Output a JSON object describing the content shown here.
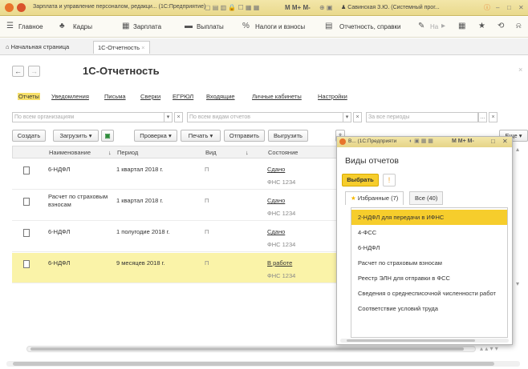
{
  "window": {
    "title": "Зарплата и управление персоналом, редакци... (1С:Предприятие)",
    "user": "Савинская З.Ю. (Системный прог..."
  },
  "menubar": {
    "items": [
      "Главное",
      "Кадры",
      "Зарплата",
      "Выплаты",
      "Налоги и взносы",
      "Отчетность, справки",
      "На"
    ]
  },
  "tabs": {
    "home": "Начальная страница",
    "active": "1С-Отчетность"
  },
  "page": {
    "title": "1С-Отчетность",
    "links": [
      "Отчеты",
      "Уведомления",
      "Письма",
      "Сверки",
      "ЕГРЮЛ",
      "Входящие",
      "Личные кабинеты",
      "Настройки"
    ],
    "filters": {
      "org_placeholder": "По всем организациям",
      "type_placeholder": "По всем видам отчетов",
      "period_placeholder": "За все периоды"
    },
    "toolbar": {
      "create": "Создать",
      "load": "Загрузить",
      "check": "Проверка",
      "print": "Печать",
      "send": "Отправить",
      "export": "Выгрузить",
      "more": "Еще"
    }
  },
  "table": {
    "columns": [
      "Наименование",
      "Период",
      "Вид",
      "Состояние"
    ],
    "rows": [
      {
        "name": "6-НДФЛ",
        "period": "1 квартал 2018 г.",
        "kind": "П",
        "status": "Сдано",
        "sub": "ФНС 1234"
      },
      {
        "name": "Расчет по страховым взносам",
        "period": "1 квартал 2018 г.",
        "kind": "П",
        "status": "Сдано",
        "sub": "ФНС 1234"
      },
      {
        "name": "6-НДФЛ",
        "period": "1 полугодие 2018 г.",
        "kind": "П",
        "status": "Сдано",
        "sub": "ФНС 1234"
      },
      {
        "name": "6-НДФЛ",
        "period": "9 месяцев 2018 г.",
        "kind": "П",
        "status": "В работе",
        "sub": "ФНС 1234"
      }
    ]
  },
  "dialog": {
    "title": "В... (1С:Предприяти",
    "heading": "Виды отчетов",
    "choose": "Выбрать",
    "tabs": [
      "Избранные (7)",
      "Все (40)"
    ],
    "items": [
      "2-НДФЛ для передачи в ИФНС",
      "4-ФСС",
      "6-НДФЛ",
      "Расчет по страховым взносам",
      "Реестр ЭЛН для отправки в ФСС",
      "Сведения о среднесписочной численности работ",
      "Соответствие условий труда"
    ]
  },
  "colors": {
    "accent": "#f6cd2c",
    "selected_row": "#faf3a8",
    "titlebar": "#efe1a0"
  }
}
